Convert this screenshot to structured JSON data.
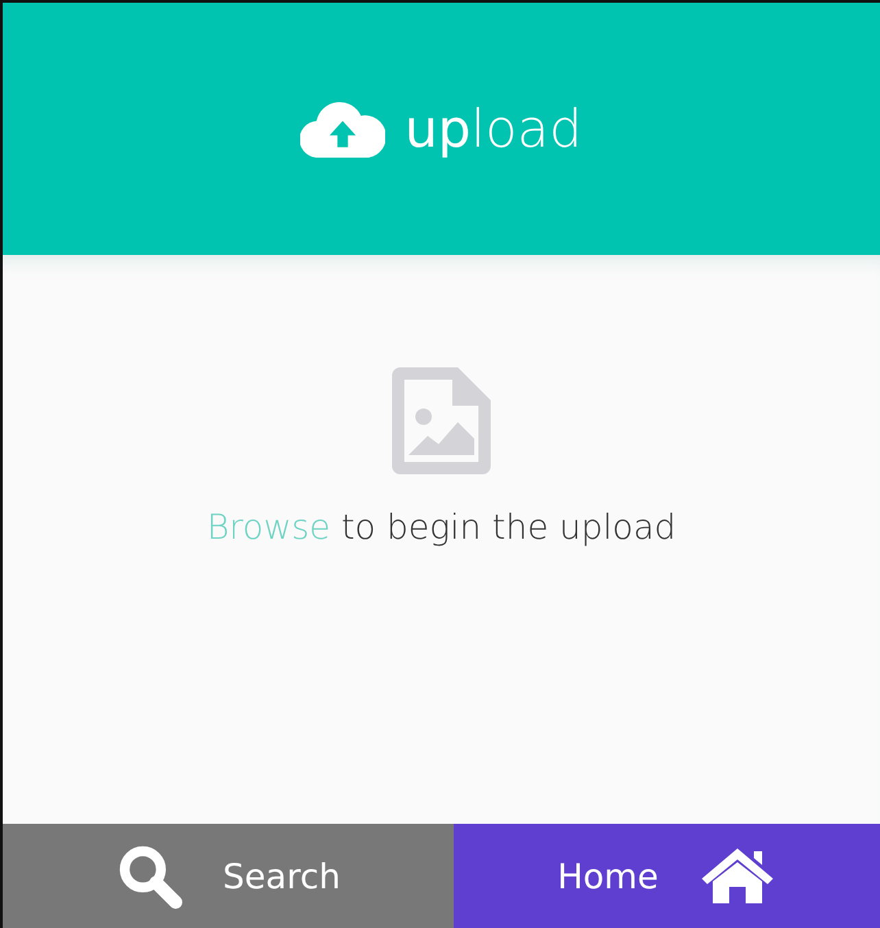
{
  "header": {
    "title": "**up**load"
  },
  "dropzone": {
    "link": "Browse",
    "text": " to begin the upload"
  },
  "nav": [
    {
      "label": "Search",
      "kind": "search",
      "color": "#787878"
    },
    {
      "label": "Home",
      "kind": "home",
      "color": "#5f3fcf"
    }
  ]
}
